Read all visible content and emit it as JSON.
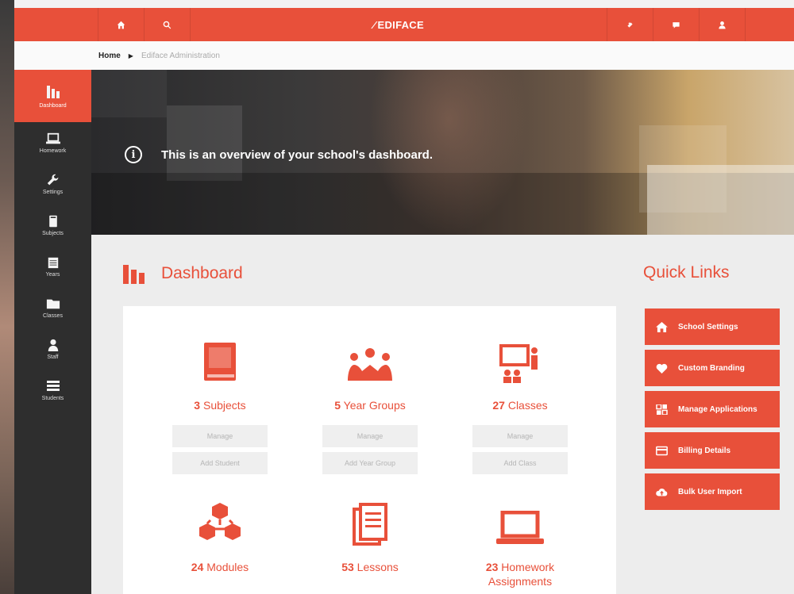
{
  "topbar": {
    "brand": "EDIFACE",
    "icons": [
      "home-icon",
      "search-icon",
      "link-icon",
      "chat-icon",
      "user-icon"
    ]
  },
  "breadcrumb": {
    "home": "Home",
    "current": "Ediface Administration"
  },
  "sidebar": {
    "items": [
      {
        "label": "Dashboard",
        "icon": "bar-chart-icon",
        "active": true
      },
      {
        "label": "Homework",
        "icon": "laptop-icon"
      },
      {
        "label": "Settings",
        "icon": "wrench-icon"
      },
      {
        "label": "Subjects",
        "icon": "book-icon"
      },
      {
        "label": "Years",
        "icon": "calendar-icon"
      },
      {
        "label": "Classes",
        "icon": "folder-icon"
      },
      {
        "label": "Staff",
        "icon": "person-icon"
      },
      {
        "label": "Students",
        "icon": "list-icon"
      }
    ]
  },
  "hero": {
    "message": "This is an overview of your school's dashboard."
  },
  "dashboard": {
    "title": "Dashboard",
    "tiles": [
      {
        "count": "3",
        "label": "Subjects",
        "icon": "book-icon",
        "btn1": "Manage",
        "btn2": "Add Student"
      },
      {
        "count": "5",
        "label": "Year Groups",
        "icon": "group-icon",
        "btn1": "Manage",
        "btn2": "Add Year Group"
      },
      {
        "count": "27",
        "label": "Classes",
        "icon": "teacher-board-icon",
        "btn1": "Manage",
        "btn2": "Add Class"
      },
      {
        "count": "24",
        "label": "Modules",
        "icon": "cubes-icon"
      },
      {
        "count": "53",
        "label": "Lessons",
        "icon": "documents-icon"
      },
      {
        "count": "23",
        "label": "Homework",
        "label2": "Assignments",
        "icon": "laptop-icon"
      }
    ]
  },
  "quick_links": {
    "title": "Quick Links",
    "items": [
      {
        "label": "School Settings",
        "icon": "home-icon"
      },
      {
        "label": "Custom Branding",
        "icon": "heart-icon"
      },
      {
        "label": "Manage Applications",
        "icon": "apps-icon"
      },
      {
        "label": "Billing Details",
        "icon": "credit-card-icon"
      },
      {
        "label": "Bulk User Import",
        "icon": "cloud-upload-icon"
      }
    ]
  },
  "colors": {
    "accent": "#e8503a",
    "sidebar": "#2e2e2e",
    "background": "#ededed"
  }
}
